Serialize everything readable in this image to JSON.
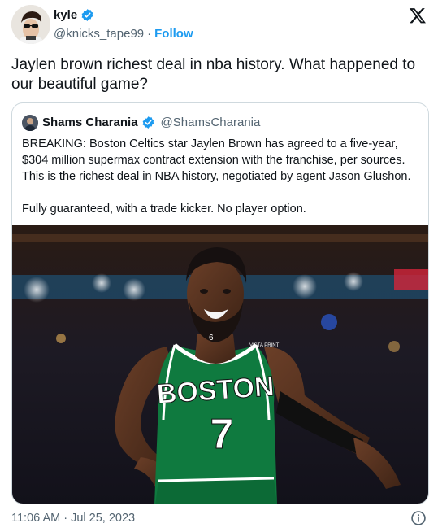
{
  "author": {
    "display_name": "kyle",
    "handle": "@knicks_tape99",
    "separator": "·",
    "follow_label": "Follow",
    "verified_color": "#1d9bf0"
  },
  "tweet": {
    "text": "Jaylen brown richest deal in nba history. What happened to our beautiful game?"
  },
  "quoted_tweet": {
    "display_name": "Shams Charania",
    "handle": "@ShamsCharania",
    "text": "BREAKING: Boston Celtics star Jaylen Brown has agreed to a five-year, $304 million supermax contract extension with the franchise, per sources. This is the richest deal in NBA history, negotiated by agent Jason Glushon.\n\nFully guaranteed, with a trade kicker. No player option.",
    "media": {
      "jersey_team": "BOSTON",
      "jersey_number": "7",
      "jersey_small_number": "6",
      "jersey_patch": "VISTA PRINT",
      "jersey_color": "#0f7a3f"
    }
  },
  "footer": {
    "timestamp": "11:06 AM · Jul 25, 2023"
  },
  "icons": {
    "brand": "x-logo-icon",
    "verified": "verified-badge-icon",
    "info": "info-icon"
  }
}
